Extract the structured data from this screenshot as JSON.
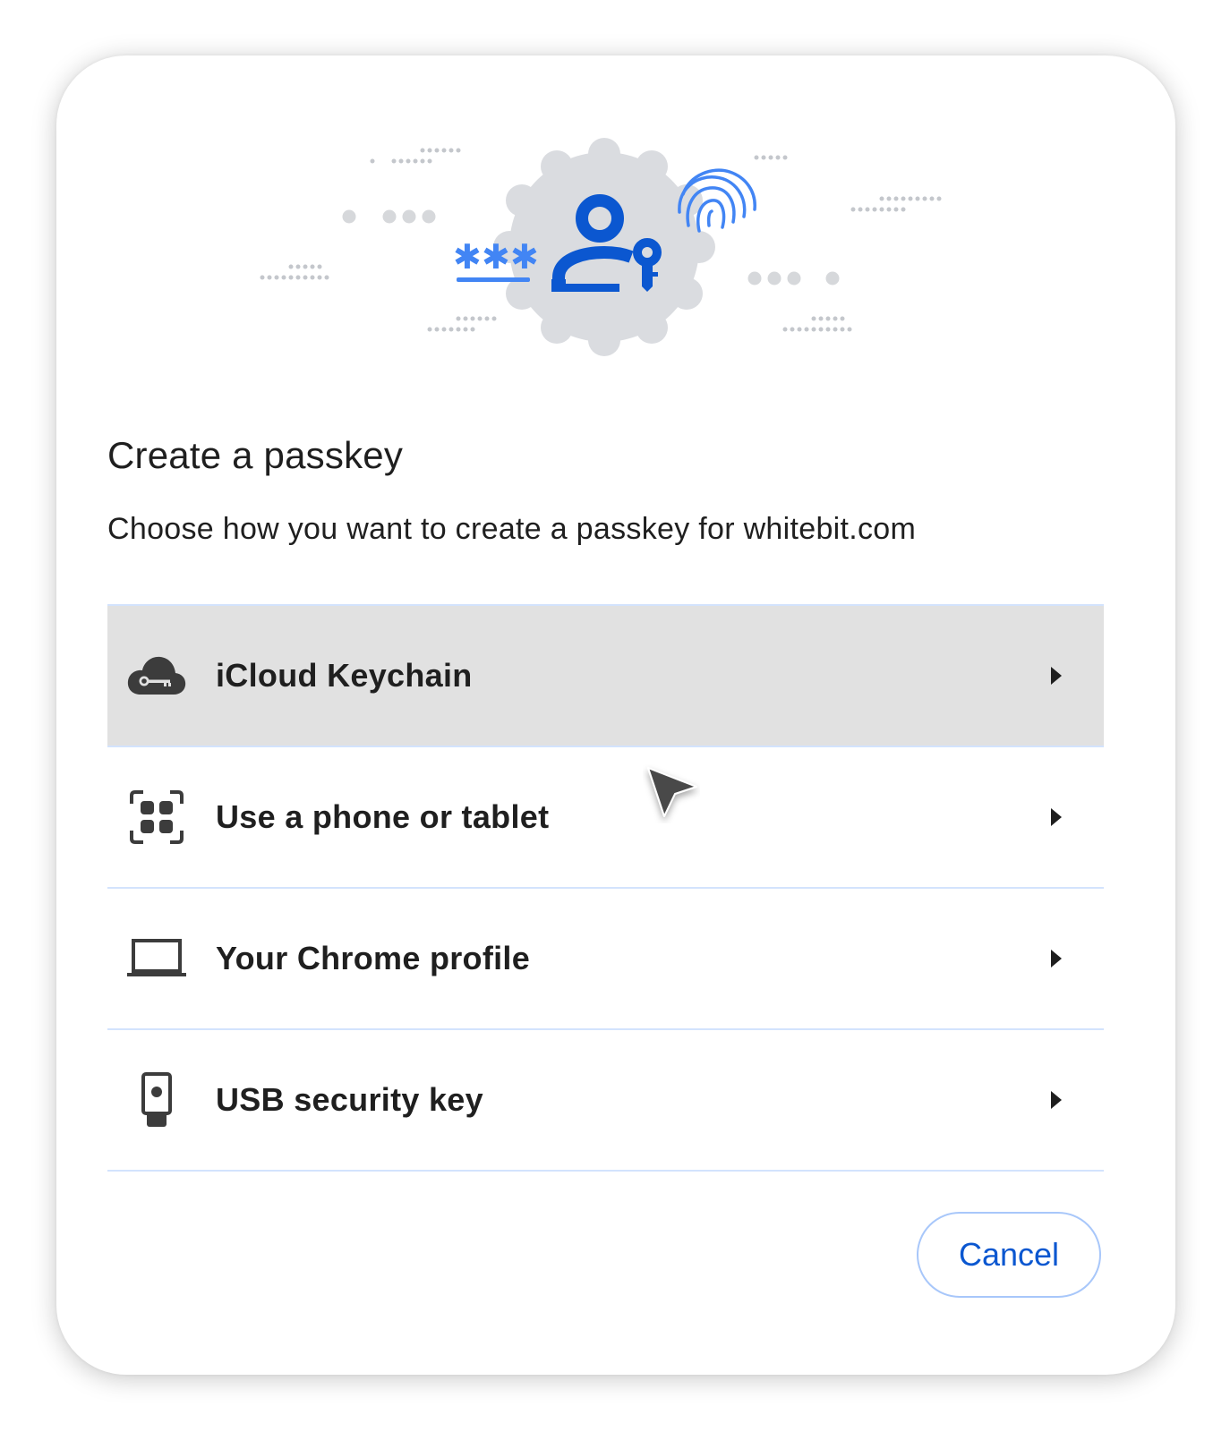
{
  "dialog": {
    "title": "Create a passkey",
    "subtitle": "Choose how you want to create a passkey for whitebit.com",
    "options": [
      {
        "label": "iCloud Keychain",
        "icon": "cloud-key-icon",
        "hovered": true
      },
      {
        "label": "Use a phone or tablet",
        "icon": "qr-code-icon",
        "hovered": false
      },
      {
        "label": "Your Chrome profile",
        "icon": "laptop-icon",
        "hovered": false
      },
      {
        "label": "USB security key",
        "icon": "usb-key-icon",
        "hovered": false
      }
    ],
    "cancel_label": "Cancel"
  },
  "illustration": {
    "password_mask": "***",
    "icons": [
      "person-key-icon",
      "fingerprint-icon"
    ]
  },
  "colors": {
    "accent": "#0b57d0",
    "accent_light": "#4285f4",
    "divider": "#d3e3fd",
    "hover_bg": "#e1e1e1",
    "badge_bg": "#dadce0"
  }
}
